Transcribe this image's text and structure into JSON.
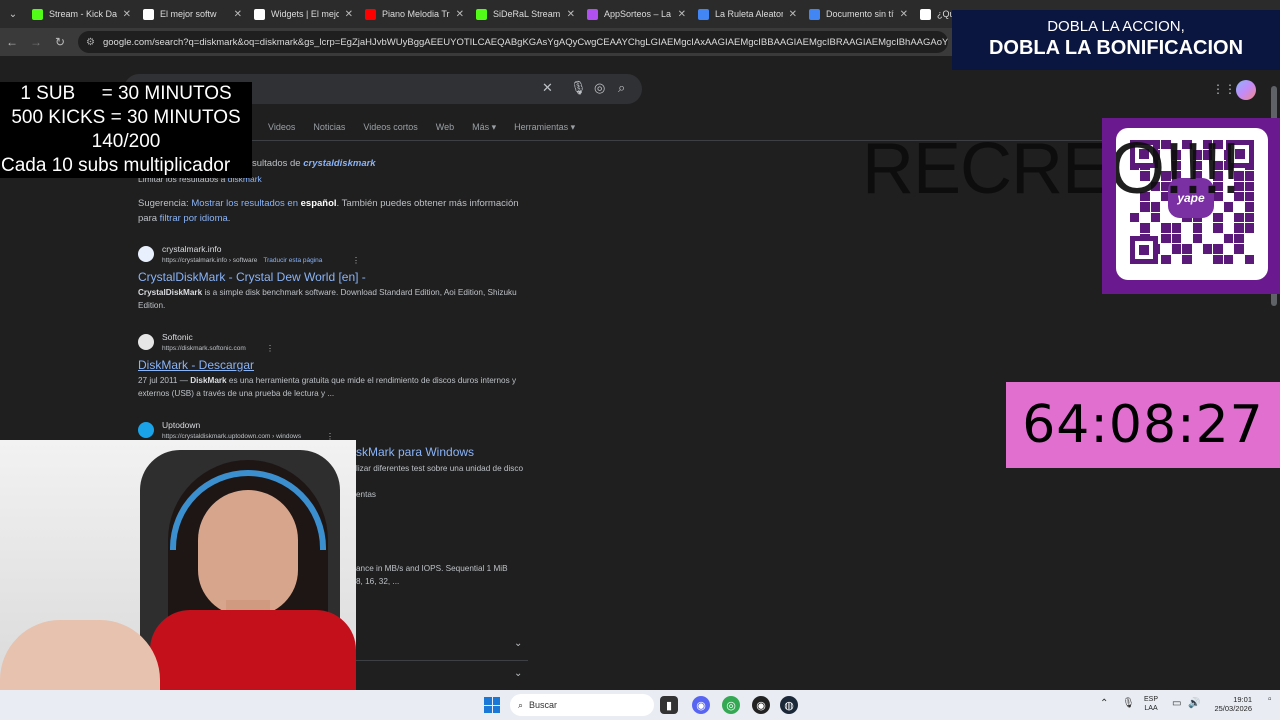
{
  "browser": {
    "tabs": [
      {
        "label": "Stream - Kick Das",
        "icon": "kick-icon",
        "color": "#53fc18"
      },
      {
        "label": "El mejor softw",
        "icon": "streamelements-icon",
        "color": "#ffffff"
      },
      {
        "label": "Widgets | El mejo",
        "icon": "widgets-icon",
        "color": "#ffffff"
      },
      {
        "label": "Piano Melodia Tri",
        "icon": "youtube-icon",
        "color": "#ff0000"
      },
      {
        "label": "SiDeRaL Stream -",
        "icon": "kick-icon",
        "color": "#53fc18"
      },
      {
        "label": "AppSorteos – La",
        "icon": "appsorteos-icon",
        "color": "#b050f0"
      },
      {
        "label": "La Ruleta Aleator",
        "icon": "roulette-icon",
        "color": "#4285f4"
      },
      {
        "label": "Documento sin tít",
        "icon": "docs-icon",
        "color": "#4285f4"
      },
      {
        "label": "¿Qué",
        "icon": "tiktok-icon",
        "color": "#ffffff"
      }
    ],
    "tab_close": "✕",
    "url": "google.com/search?q=diskmark&oq=diskmark&gs_lcrp=EgZjaHJvbWUyBggAEEUYOTILCAEQABgKGAsYgAQyCwgCEAAYChgLGIAEMgcIAxAAGIAEMgcIBBAAGIAEMgcIBRAAGIAEMgcIBhAAGAoYCxiABDIJCAc"
  },
  "google": {
    "tabs": [
      "Videos",
      "Noticias",
      "Videos cortos",
      "Web",
      "Más ▾",
      "Herramientas ▾"
    ],
    "showing_prefix": "sultados de ",
    "showing_query": "crystaldiskmark",
    "limit_prefix": "Limitar los resultados a ",
    "limit_query": "diskmark",
    "suggest_prefix": "Sugerencia: ",
    "suggest_link": "Mostrar los resultados en ",
    "suggest_lang": "español",
    "suggest_rest": ". También puedes obtener más información",
    "suggest_para": "para ",
    "suggest_filter": "filtrar por idioma",
    "suggest_end": ".",
    "results": [
      {
        "site": "crystalmark.info",
        "url": "https://crystalmark.info › software",
        "translate": "Traducir esta página",
        "title": "CrystalDiskMark - Crystal Dew World [en] -",
        "desc_bold": "CrystalDiskMark",
        "desc": " is a simple disk benchmark software. Download Standard Edition, Aoi Edition, Shizuku",
        "desc2": "Edition."
      },
      {
        "site": "Softonic",
        "url": "https://diskmark.softonic.com",
        "title": "DiskMark - Descargar",
        "date": "27 jul 2011 — ",
        "desc_bold": "DiskMark",
        "desc": " es una herramienta gratuita que mide el rendimiento de discos duros internos y",
        "desc2": "externos (USB) a través de una prueba de lectura y ..."
      },
      {
        "site": "Uptodown",
        "url": "https://crystaldiskmark.uptodown.com › windows",
        "title": "skMark para Windows",
        "desc": "lizar diferentes test sobre una unidad de disco",
        "desc2": "entas"
      }
    ],
    "partial_desc1": "ance in MB/s and IOPS. Sequential 1 MiB",
    "partial_desc2": " 8, 16, 32, ..."
  },
  "overlays": {
    "sub_lines": [
      "1 SUB     = 30 MINUTOS",
      "500 KICKS = 30 MINUTOS",
      "140/200",
      "Cada 10 subs multiplicador"
    ],
    "banner_line1": "DOBLA LA ACCION,",
    "banner_line2": "DOBLA LA BONIFICACION",
    "recreo": "RECREO!!!!",
    "qr_brand": "yape",
    "timer": "64:08:27"
  },
  "taskbar": {
    "search_placeholder": "Buscar",
    "lang_line1": "ESP",
    "lang_line2": "LAA",
    "time": "19:01",
    "date": "25/03/2026"
  },
  "colors": {
    "banner_bg": "#0b1640",
    "timer_bg": "#e06fd0",
    "qr_frame": "#6a1a8e",
    "link": "#8ab4f8"
  }
}
